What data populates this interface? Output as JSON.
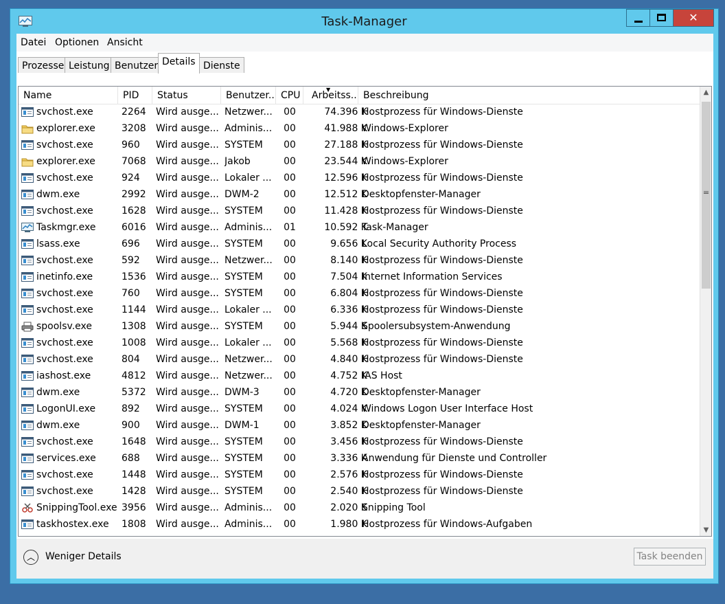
{
  "window": {
    "title": "Task-Manager",
    "close_glyph": "✕"
  },
  "menu": [
    "Datei",
    "Optionen",
    "Ansicht"
  ],
  "tabs": [
    "Prozesse",
    "Leistung",
    "Benutzer",
    "Details",
    "Dienste"
  ],
  "active_tab": "Details",
  "columns": {
    "name": "Name",
    "pid": "PID",
    "status": "Status",
    "user": "Benutzer...",
    "cpu": "CPU",
    "mem": "Arbeitss...",
    "desc": "Beschreibung",
    "sorted_by": "mem",
    "sort_direction": "descending"
  },
  "processes": [
    {
      "icon": "service-host-icon",
      "name": "svchost.exe",
      "pid": "2264",
      "status": "Wird ausge...",
      "user": "Netzwer...",
      "cpu": "00",
      "mem": "74.396 K",
      "desc": "Hostprozess für Windows-Dienste"
    },
    {
      "icon": "folder-icon",
      "name": "explorer.exe",
      "pid": "3208",
      "status": "Wird ausge...",
      "user": "Adminis...",
      "cpu": "00",
      "mem": "41.988 K",
      "desc": "Windows-Explorer"
    },
    {
      "icon": "service-host-icon",
      "name": "svchost.exe",
      "pid": "960",
      "status": "Wird ausge...",
      "user": "SYSTEM",
      "cpu": "00",
      "mem": "27.188 K",
      "desc": "Hostprozess für Windows-Dienste"
    },
    {
      "icon": "folder-icon",
      "name": "explorer.exe",
      "pid": "7068",
      "status": "Wird ausge...",
      "user": "Jakob",
      "cpu": "00",
      "mem": "23.544 K",
      "desc": "Windows-Explorer"
    },
    {
      "icon": "service-host-icon",
      "name": "svchost.exe",
      "pid": "924",
      "status": "Wird ausge...",
      "user": "Lokaler ...",
      "cpu": "00",
      "mem": "12.596 K",
      "desc": "Hostprozess für Windows-Dienste"
    },
    {
      "icon": "service-host-icon",
      "name": "dwm.exe",
      "pid": "2992",
      "status": "Wird ausge...",
      "user": "DWM-2",
      "cpu": "00",
      "mem": "12.512 K",
      "desc": "Desktopfenster-Manager"
    },
    {
      "icon": "service-host-icon",
      "name": "svchost.exe",
      "pid": "1628",
      "status": "Wird ausge...",
      "user": "SYSTEM",
      "cpu": "00",
      "mem": "11.428 K",
      "desc": "Hostprozess für Windows-Dienste"
    },
    {
      "icon": "task-manager-icon",
      "name": "Taskmgr.exe",
      "pid": "6016",
      "status": "Wird ausge...",
      "user": "Adminis...",
      "cpu": "01",
      "mem": "10.592 K",
      "desc": "Task-Manager"
    },
    {
      "icon": "service-host-icon",
      "name": "lsass.exe",
      "pid": "696",
      "status": "Wird ausge...",
      "user": "SYSTEM",
      "cpu": "00",
      "mem": "9.656 K",
      "desc": "Local Security Authority Process"
    },
    {
      "icon": "service-host-icon",
      "name": "svchost.exe",
      "pid": "592",
      "status": "Wird ausge...",
      "user": "Netzwer...",
      "cpu": "00",
      "mem": "8.140 K",
      "desc": "Hostprozess für Windows-Dienste"
    },
    {
      "icon": "service-host-icon",
      "name": "inetinfo.exe",
      "pid": "1536",
      "status": "Wird ausge...",
      "user": "SYSTEM",
      "cpu": "00",
      "mem": "7.504 K",
      "desc": "Internet Information Services"
    },
    {
      "icon": "service-host-icon",
      "name": "svchost.exe",
      "pid": "760",
      "status": "Wird ausge...",
      "user": "SYSTEM",
      "cpu": "00",
      "mem": "6.804 K",
      "desc": "Hostprozess für Windows-Dienste"
    },
    {
      "icon": "service-host-icon",
      "name": "svchost.exe",
      "pid": "1144",
      "status": "Wird ausge...",
      "user": "Lokaler ...",
      "cpu": "00",
      "mem": "6.336 K",
      "desc": "Hostprozess für Windows-Dienste"
    },
    {
      "icon": "printer-icon",
      "name": "spoolsv.exe",
      "pid": "1308",
      "status": "Wird ausge...",
      "user": "SYSTEM",
      "cpu": "00",
      "mem": "5.944 K",
      "desc": "Spoolersubsystem-Anwendung"
    },
    {
      "icon": "service-host-icon",
      "name": "svchost.exe",
      "pid": "1008",
      "status": "Wird ausge...",
      "user": "Lokaler ...",
      "cpu": "00",
      "mem": "5.568 K",
      "desc": "Hostprozess für Windows-Dienste"
    },
    {
      "icon": "service-host-icon",
      "name": "svchost.exe",
      "pid": "804",
      "status": "Wird ausge...",
      "user": "Netzwer...",
      "cpu": "00",
      "mem": "4.840 K",
      "desc": "Hostprozess für Windows-Dienste"
    },
    {
      "icon": "service-host-icon",
      "name": "iashost.exe",
      "pid": "4812",
      "status": "Wird ausge...",
      "user": "Netzwer...",
      "cpu": "00",
      "mem": "4.752 K",
      "desc": "IAS Host"
    },
    {
      "icon": "service-host-icon",
      "name": "dwm.exe",
      "pid": "5372",
      "status": "Wird ausge...",
      "user": "DWM-3",
      "cpu": "00",
      "mem": "4.720 K",
      "desc": "Desktopfenster-Manager"
    },
    {
      "icon": "service-host-icon",
      "name": "LogonUI.exe",
      "pid": "892",
      "status": "Wird ausge...",
      "user": "SYSTEM",
      "cpu": "00",
      "mem": "4.024 K",
      "desc": "Windows Logon User Interface Host"
    },
    {
      "icon": "service-host-icon",
      "name": "dwm.exe",
      "pid": "900",
      "status": "Wird ausge...",
      "user": "DWM-1",
      "cpu": "00",
      "mem": "3.852 K",
      "desc": "Desktopfenster-Manager"
    },
    {
      "icon": "service-host-icon",
      "name": "svchost.exe",
      "pid": "1648",
      "status": "Wird ausge...",
      "user": "SYSTEM",
      "cpu": "00",
      "mem": "3.456 K",
      "desc": "Hostprozess für Windows-Dienste"
    },
    {
      "icon": "service-host-icon",
      "name": "services.exe",
      "pid": "688",
      "status": "Wird ausge...",
      "user": "SYSTEM",
      "cpu": "00",
      "mem": "3.336 K",
      "desc": "Anwendung für Dienste und Controller"
    },
    {
      "icon": "service-host-icon",
      "name": "svchost.exe",
      "pid": "1448",
      "status": "Wird ausge...",
      "user": "SYSTEM",
      "cpu": "00",
      "mem": "2.576 K",
      "desc": "Hostprozess für Windows-Dienste"
    },
    {
      "icon": "service-host-icon",
      "name": "svchost.exe",
      "pid": "1428",
      "status": "Wird ausge...",
      "user": "SYSTEM",
      "cpu": "00",
      "mem": "2.540 K",
      "desc": "Hostprozess für Windows-Dienste"
    },
    {
      "icon": "snipping-tool-icon",
      "name": "SnippingTool.exe",
      "pid": "3956",
      "status": "Wird ausge...",
      "user": "Adminis...",
      "cpu": "00",
      "mem": "2.020 K",
      "desc": "Snipping Tool"
    },
    {
      "icon": "service-host-icon",
      "name": "taskhostex.exe",
      "pid": "1808",
      "status": "Wird ausge...",
      "user": "Adminis...",
      "cpu": "00",
      "mem": "1.980 K",
      "desc": "Hostprozess für Windows-Aufgaben"
    }
  ],
  "footer": {
    "fewer_details": "Weniger Details",
    "end_task": "Task beenden"
  },
  "colors": {
    "frame": "#60c9ec",
    "desktop": "#3b6ea5",
    "close": "#c7443b"
  }
}
